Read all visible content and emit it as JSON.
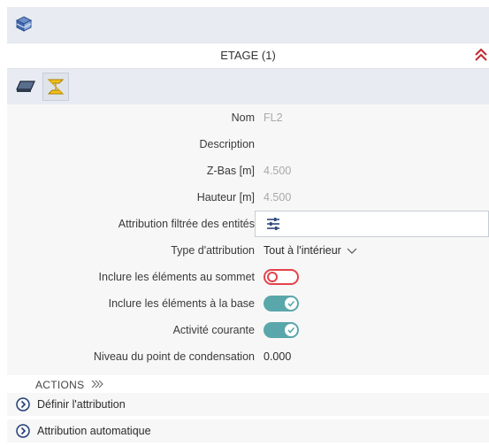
{
  "panel": {
    "header_title": "ETAGE (1)",
    "top_icon": "layers-cube-icon",
    "collapse_icon": "double-chevron-up-icon",
    "toolbar_icons": [
      "slab-plane-icon",
      "steel-beam-icon"
    ]
  },
  "properties": [
    {
      "label": "Nom",
      "value": "FL2"
    },
    {
      "label": "Description",
      "value": ""
    },
    {
      "label": "Z-Bas [m]",
      "value": "4.500"
    },
    {
      "label": "Hauteur [m]",
      "value": "4.500"
    },
    {
      "label": "Attribution filtrée des entités",
      "icon": "filter-sliders-icon"
    },
    {
      "label": "Type d'attribution",
      "value": "Tout à l'intérieur"
    },
    {
      "label": "Inclure les éléments au sommet",
      "toggle": false
    },
    {
      "label": "Inclure les éléments à la base",
      "toggle": true
    },
    {
      "label": "Activité courante",
      "toggle": true
    },
    {
      "label": "Niveau du point de condensation",
      "value": "0.000"
    }
  ],
  "actions": {
    "header": "ACTIONS",
    "items": [
      {
        "label": "Définir l'attribution",
        "icon": "circle-chevron-right-icon"
      },
      {
        "label": "Attribution automatique",
        "icon": "circle-chevron-right-icon"
      }
    ]
  },
  "colors": {
    "toggle_on": "#5aa7ab",
    "toggle_off": "#e3434b",
    "collapse_icon": "#c0262d"
  }
}
